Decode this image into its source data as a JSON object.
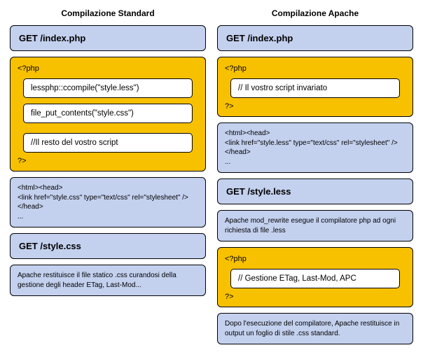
{
  "left": {
    "title": "Compilazione Standard",
    "req1": "GET /index.php",
    "php": {
      "open": "<?php",
      "l1": "lessphp::ccompile(\"style.less\")",
      "l2": "file_put_contents(\"style.css\")",
      "l3": "//Il resto del vostro script",
      "close": "?>"
    },
    "html": {
      "l1": "<html><head>",
      "l2": "<link href=\"style.css\" type=\"text/css\" rel=\"stylesheet\" />",
      "l3": "</head>",
      "l4": "..."
    },
    "req2": "GET /style.css",
    "note": "Apache restituisce il file statico .css curandosi della gestione degli header ETag, Last-Mod..."
  },
  "right": {
    "title": "Compilazione Apache",
    "req1": "GET /index.php",
    "php1": {
      "open": "<?php",
      "l1": "// Il vostro script invariato",
      "close": "?>"
    },
    "html": {
      "l1": "<html><head>",
      "l2": "<link href=\"style.less\" type=\"text/css\" rel=\"stylesheet\" />",
      "l3": "</head>",
      "l4": "..."
    },
    "req2": "GET /style.less",
    "note1": "Apache mod_rewrite esegue il compilatore php ad ogni richiesta di file .less",
    "php2": {
      "open": "<?php",
      "l1": "// Gestione ETag, Last-Mod, APC",
      "close": "?>"
    },
    "note2": "Dopo l'esecuzione del compilatore, Apache restituisce in output un foglio di stile .css standard."
  }
}
